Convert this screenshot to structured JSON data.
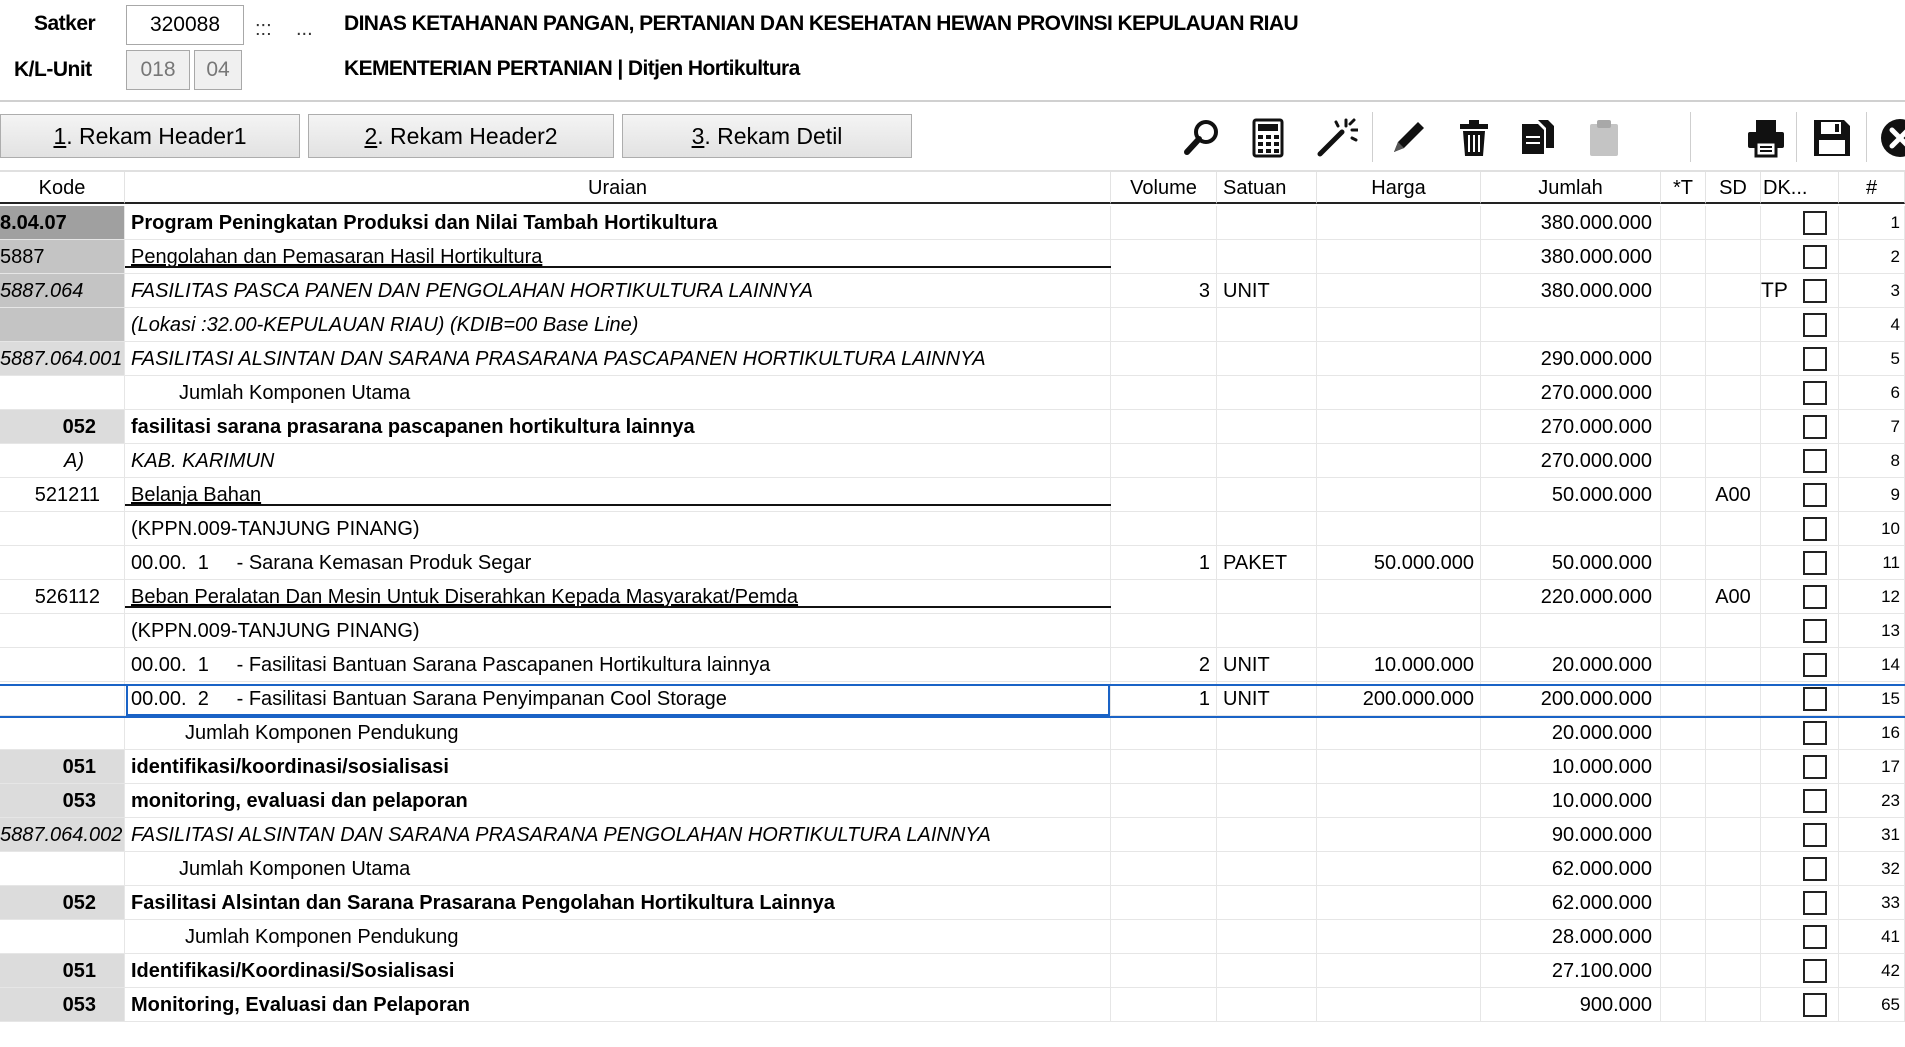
{
  "header": {
    "satker_label": "Satker",
    "satker_value": "320088",
    "sep1": ":::",
    "sep2": "...",
    "satker_name": "DINAS KETAHANAN PANGAN, PERTANIAN DAN KESEHATAN HEWAN PROVINSI KEPULAUAN RIAU",
    "kl_unit_label": "K/L-Unit",
    "kl_value": "018",
    "unit_value": "04",
    "kementerian": "KEMENTERIAN PERTANIAN | Ditjen Hortikultura"
  },
  "toolbar": {
    "btn1_num": "1",
    "btn1_label": ". Rekam Header1",
    "btn2_num": "2",
    "btn2_label": ". Rekam Header2",
    "btn3_num": "3",
    "btn3_label": ". Rekam Detil",
    "icons": [
      "search-icon",
      "calculator-icon",
      "magic-wand-icon",
      "pencil-icon",
      "trash-icon",
      "copy-icon",
      "paste-icon",
      "print-icon",
      "save-icon",
      "close-icon"
    ]
  },
  "columns": {
    "kode": "Kode",
    "uraian": "Uraian",
    "volume": "Volume",
    "satuan": "Satuan",
    "harga": "Harga",
    "jumlah": "Jumlah",
    "t": "*T",
    "sd": "SD",
    "dk": "DK...",
    "num": "#"
  },
  "rows": [
    {
      "kode": "8.04.07",
      "uraian": "Program Peningkatan Produksi dan Nilai Tambah Hortikultura",
      "volume": "",
      "satuan": "",
      "harga": "",
      "jumlah": "380.000.000",
      "sd": "",
      "dk": "",
      "num": "1"
    },
    {
      "kode": "5887",
      "uraian": "Pengolahan dan Pemasaran Hasil Hortikultura",
      "volume": "",
      "satuan": "",
      "harga": "",
      "jumlah": "380.000.000",
      "sd": "",
      "dk": "",
      "num": "2"
    },
    {
      "kode": "5887.064",
      "uraian": "FASILITAS PASCA PANEN DAN PENGOLAHAN HORTIKULTURA LAINNYA",
      "volume": "3",
      "satuan": "UNIT",
      "harga": "",
      "jumlah": "380.000.000",
      "sd": "",
      "dk": "TP",
      "num": "3"
    },
    {
      "kode": "",
      "uraian": "(Lokasi :32.00-KEPULAUAN RIAU) (KDIB=00 Base Line)",
      "volume": "",
      "satuan": "",
      "harga": "",
      "jumlah": "",
      "sd": "",
      "dk": "",
      "num": "4"
    },
    {
      "kode": "5887.064.001",
      "uraian": "FASILITASI ALSINTAN DAN SARANA PRASARANA PASCAPANEN HORTIKULTURA LAINNYA",
      "volume": "",
      "satuan": "",
      "harga": "",
      "jumlah": "290.000.000",
      "sd": "",
      "dk": "",
      "num": "5"
    },
    {
      "kode": "",
      "uraian": "Jumlah Komponen Utama",
      "volume": "",
      "satuan": "",
      "harga": "",
      "jumlah": "270.000.000",
      "sd": "",
      "dk": "",
      "num": "6"
    },
    {
      "kode": "052",
      "uraian": "fasilitasi sarana prasarana pascapanen hortikultura lainnya",
      "volume": "",
      "satuan": "",
      "harga": "",
      "jumlah": "270.000.000",
      "sd": "",
      "dk": "",
      "num": "7"
    },
    {
      "kode": "A)",
      "uraian": "KAB. KARIMUN",
      "volume": "",
      "satuan": "",
      "harga": "",
      "jumlah": "270.000.000",
      "sd": "",
      "dk": "",
      "num": "8"
    },
    {
      "kode": "521211",
      "uraian": "Belanja Bahan",
      "volume": "",
      "satuan": "",
      "harga": "",
      "jumlah": "50.000.000",
      "sd": "A00",
      "dk": "",
      "num": "9"
    },
    {
      "kode": "",
      "uraian": "(KPPN.009-TANJUNG PINANG)",
      "volume": "",
      "satuan": "",
      "harga": "",
      "jumlah": "",
      "sd": "",
      "dk": "",
      "num": "10"
    },
    {
      "kode": "",
      "uraian": "00.00.  1     - Sarana Kemasan Produk Segar",
      "volume": "1",
      "satuan": "PAKET",
      "harga": "50.000.000",
      "jumlah": "50.000.000",
      "sd": "",
      "dk": "",
      "num": "11"
    },
    {
      "kode": "526112",
      "uraian": "Beban Peralatan Dan Mesin Untuk Diserahkan Kepada Masyarakat/Pemda",
      "volume": "",
      "satuan": "",
      "harga": "",
      "jumlah": "220.000.000",
      "sd": "A00",
      "dk": "",
      "num": "12"
    },
    {
      "kode": "",
      "uraian": "(KPPN.009-TANJUNG PINANG)",
      "volume": "",
      "satuan": "",
      "harga": "",
      "jumlah": "",
      "sd": "",
      "dk": "",
      "num": "13"
    },
    {
      "kode": "",
      "uraian": "00.00.  1     - Fasilitasi Bantuan Sarana Pascapanen Hortikultura lainnya",
      "volume": "2",
      "satuan": "UNIT",
      "harga": "10.000.000",
      "jumlah": "20.000.000",
      "sd": "",
      "dk": "",
      "num": "14"
    },
    {
      "kode": "",
      "uraian": "00.00.  2     - Fasilitasi Bantuan Sarana Penyimpanan Cool Storage",
      "volume": "1",
      "satuan": "UNIT",
      "harga": "200.000.000",
      "jumlah": "200.000.000",
      "sd": "",
      "dk": "",
      "num": "15"
    },
    {
      "kode": "",
      "uraian": "Jumlah Komponen Pendukung",
      "volume": "",
      "satuan": "",
      "harga": "",
      "jumlah": "20.000.000",
      "sd": "",
      "dk": "",
      "num": "16"
    },
    {
      "kode": "051",
      "uraian": "identifikasi/koordinasi/sosialisasi",
      "volume": "",
      "satuan": "",
      "harga": "",
      "jumlah": "10.000.000",
      "sd": "",
      "dk": "",
      "num": "17"
    },
    {
      "kode": "053",
      "uraian": "monitoring, evaluasi dan pelaporan",
      "volume": "",
      "satuan": "",
      "harga": "",
      "jumlah": "10.000.000",
      "sd": "",
      "dk": "",
      "num": "23"
    },
    {
      "kode": "5887.064.002",
      "uraian": "FASILITASI ALSINTAN DAN SARANA PRASARANA PENGOLAHAN HORTIKULTURA LAINNYA",
      "volume": "",
      "satuan": "",
      "harga": "",
      "jumlah": "90.000.000",
      "sd": "",
      "dk": "",
      "num": "31"
    },
    {
      "kode": "",
      "uraian": "Jumlah Komponen Utama",
      "volume": "",
      "satuan": "",
      "harga": "",
      "jumlah": "62.000.000",
      "sd": "",
      "dk": "",
      "num": "32"
    },
    {
      "kode": "052",
      "uraian": "Fasilitasi Alsintan dan Sarana Prasarana Pengolahan Hortikultura Lainnya",
      "volume": "",
      "satuan": "",
      "harga": "",
      "jumlah": "62.000.000",
      "sd": "",
      "dk": "",
      "num": "33"
    },
    {
      "kode": "",
      "uraian": "Jumlah Komponen Pendukung",
      "volume": "",
      "satuan": "",
      "harga": "",
      "jumlah": "28.000.000",
      "sd": "",
      "dk": "",
      "num": "41"
    },
    {
      "kode": "051",
      "uraian": "Identifikasi/Koordinasi/Sosialisasi",
      "volume": "",
      "satuan": "",
      "harga": "",
      "jumlah": "27.100.000",
      "sd": "",
      "dk": "",
      "num": "42"
    },
    {
      "kode": "053",
      "uraian": "Monitoring, Evaluasi dan Pelaporan",
      "volume": "",
      "satuan": "",
      "harga": "",
      "jumlah": "900.000",
      "sd": "",
      "dk": "",
      "num": "65"
    }
  ]
}
